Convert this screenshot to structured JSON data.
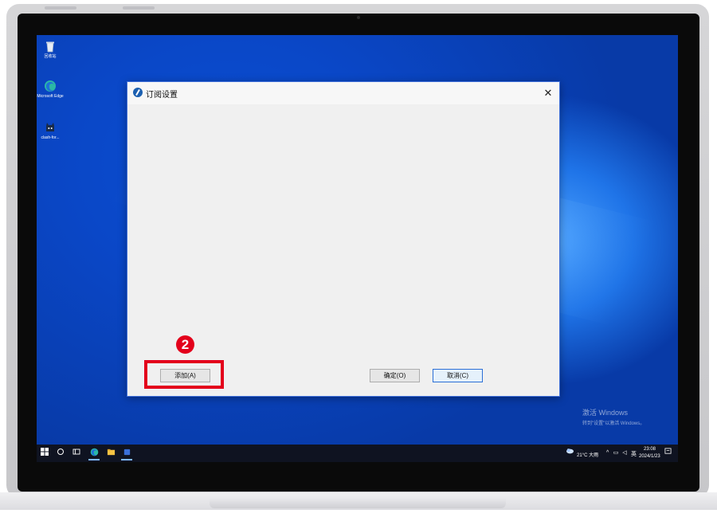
{
  "desktop": {
    "icons": [
      {
        "label": "回收站",
        "icon": "recycle-bin-icon"
      },
      {
        "label": "Microsoft Edge",
        "icon": "edge-icon"
      },
      {
        "label": "clash-for...",
        "icon": "clash-cat-icon"
      }
    ],
    "watermark": {
      "line1": "激活 Windows",
      "line2": "转到\"设置\"以激活 Windows。"
    }
  },
  "dialog": {
    "title": "订阅设置",
    "close_glyph": "✕",
    "add_label": "添加(A)",
    "ok_label": "确定(O)",
    "cancel_label": "取消(C)"
  },
  "annotation": {
    "step_number": "2",
    "color": "#e3001b"
  },
  "taskbar": {
    "weather": "21°C 大雨",
    "ime": "英",
    "tray_arrow": "^",
    "time": "23:08",
    "date": "2024/1/23"
  },
  "colors": {
    "wallpaper": "#0a47c7",
    "dialog_border": "#3f6fd8",
    "primary_button_border": "#2b6fd6",
    "taskbar": "#0f1321"
  }
}
